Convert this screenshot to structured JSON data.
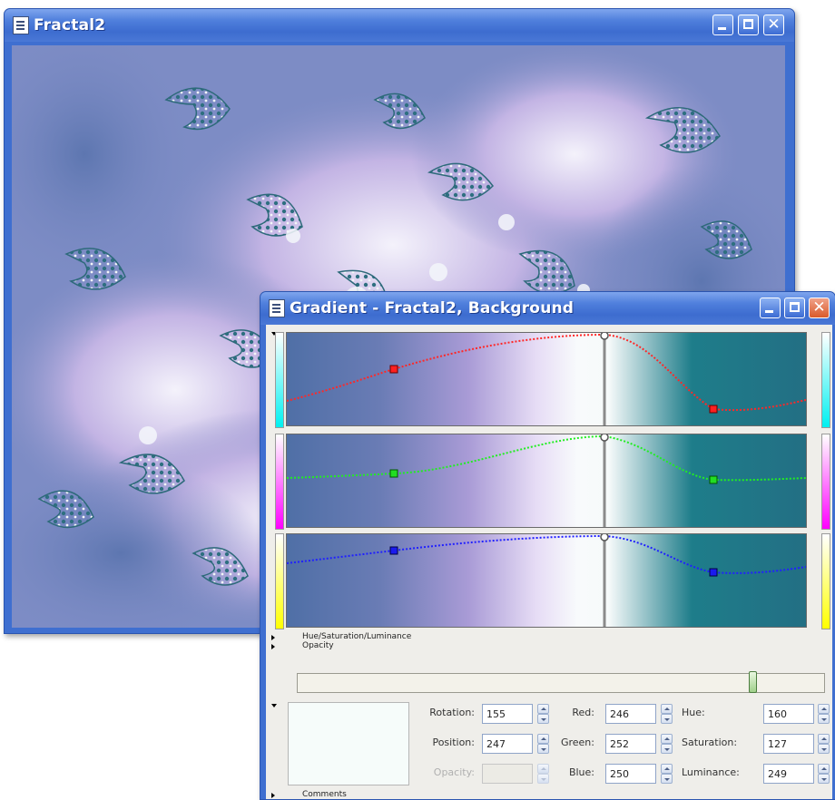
{
  "fractal_window": {
    "title": "Fractal2",
    "icon": "document-icon"
  },
  "gradient_window": {
    "title": "Gradient - Fractal2, Background",
    "icon": "document-icon",
    "channel_colors": {
      "red_curve": "#ff2020",
      "green_curve": "#22ee22",
      "blue_curve": "#2020ff",
      "left_strips": [
        "#00f0f0",
        "#ff00ff",
        "#ffff00"
      ],
      "right_strips": [
        "#00f0f0",
        "#ff00ff",
        "#ffff00"
      ]
    },
    "sections": {
      "hsl": "Hue/Saturation/Luminance",
      "opacity": "Opacity",
      "comments": "Comments"
    },
    "slider_position": 0.87,
    "swatch_color": "#f6fcfa",
    "fields": {
      "rotation_label": "Rotation:",
      "rotation_value": "155",
      "position_label": "Position:",
      "position_value": "247",
      "opacity_label": "Opacity:",
      "opacity_value": "",
      "red_label": "Red:",
      "red_value": "246",
      "green_label": "Green:",
      "green_value": "252",
      "blue_label": "Blue:",
      "blue_value": "250",
      "hue_label": "Hue:",
      "hue_value": "160",
      "saturation_label": "Saturation:",
      "saturation_value": "127",
      "luminance_label": "Luminance:",
      "luminance_value": "249"
    }
  }
}
